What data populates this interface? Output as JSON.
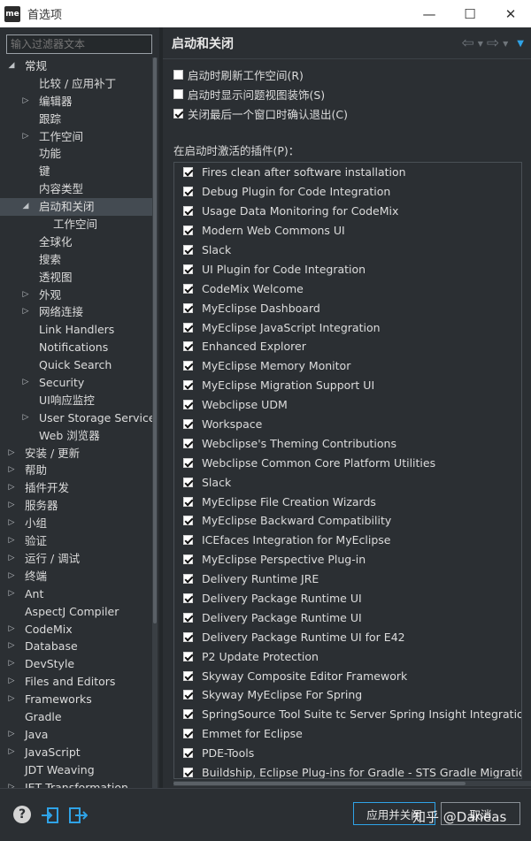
{
  "window": {
    "logo": "me",
    "title": "首选项",
    "minimize": "—",
    "maximize": "☐",
    "close": "✕"
  },
  "filter": {
    "placeholder": "输入过滤器文本"
  },
  "tree": [
    {
      "label": "常规",
      "level": 0,
      "arrow": "expanded"
    },
    {
      "label": "比较 / 应用补丁",
      "level": 1,
      "arrow": "none"
    },
    {
      "label": "编辑器",
      "level": 1,
      "arrow": "collapsed"
    },
    {
      "label": "跟踪",
      "level": 1,
      "arrow": "none"
    },
    {
      "label": "工作空间",
      "level": 1,
      "arrow": "collapsed"
    },
    {
      "label": "功能",
      "level": 1,
      "arrow": "none"
    },
    {
      "label": "键",
      "level": 1,
      "arrow": "none"
    },
    {
      "label": "内容类型",
      "level": 1,
      "arrow": "none"
    },
    {
      "label": "启动和关闭",
      "level": 1,
      "arrow": "expanded",
      "selected": true
    },
    {
      "label": "工作空间",
      "level": 2,
      "arrow": "none"
    },
    {
      "label": "全球化",
      "level": 1,
      "arrow": "none"
    },
    {
      "label": "搜索",
      "level": 1,
      "arrow": "none"
    },
    {
      "label": "透视图",
      "level": 1,
      "arrow": "none"
    },
    {
      "label": "外观",
      "level": 1,
      "arrow": "collapsed"
    },
    {
      "label": "网络连接",
      "level": 1,
      "arrow": "collapsed"
    },
    {
      "label": "Link Handlers",
      "level": 1,
      "arrow": "none"
    },
    {
      "label": "Notifications",
      "level": 1,
      "arrow": "none"
    },
    {
      "label": "Quick Search",
      "level": 1,
      "arrow": "none"
    },
    {
      "label": "Security",
      "level": 1,
      "arrow": "collapsed"
    },
    {
      "label": "UI响应监控",
      "level": 1,
      "arrow": "none"
    },
    {
      "label": "User Storage Service",
      "level": 1,
      "arrow": "collapsed"
    },
    {
      "label": "Web 浏览器",
      "level": 1,
      "arrow": "none"
    },
    {
      "label": "安装 / 更新",
      "level": 0,
      "arrow": "collapsed"
    },
    {
      "label": "帮助",
      "level": 0,
      "arrow": "collapsed"
    },
    {
      "label": "插件开发",
      "level": 0,
      "arrow": "collapsed"
    },
    {
      "label": "服务器",
      "level": 0,
      "arrow": "collapsed"
    },
    {
      "label": "小组",
      "level": 0,
      "arrow": "collapsed"
    },
    {
      "label": "验证",
      "level": 0,
      "arrow": "collapsed"
    },
    {
      "label": "运行 / 调试",
      "level": 0,
      "arrow": "collapsed"
    },
    {
      "label": "终端",
      "level": 0,
      "arrow": "collapsed"
    },
    {
      "label": "Ant",
      "level": 0,
      "arrow": "collapsed"
    },
    {
      "label": "AspectJ Compiler",
      "level": 0,
      "arrow": "none"
    },
    {
      "label": "CodeMix",
      "level": 0,
      "arrow": "collapsed"
    },
    {
      "label": "Database",
      "level": 0,
      "arrow": "collapsed"
    },
    {
      "label": "DevStyle",
      "level": 0,
      "arrow": "collapsed"
    },
    {
      "label": "Files and Editors",
      "level": 0,
      "arrow": "collapsed"
    },
    {
      "label": "Frameworks",
      "level": 0,
      "arrow": "collapsed"
    },
    {
      "label": "Gradle",
      "level": 0,
      "arrow": "none"
    },
    {
      "label": "Java",
      "level": 0,
      "arrow": "collapsed"
    },
    {
      "label": "JavaScript",
      "level": 0,
      "arrow": "collapsed"
    },
    {
      "label": "JDT Weaving",
      "level": 0,
      "arrow": "none"
    },
    {
      "label": "JET Transformation",
      "level": 0,
      "arrow": "collapsed"
    }
  ],
  "page": {
    "title": "启动和关闭",
    "back_icon": "arrow-left-icon",
    "forward_icon": "arrow-right-icon",
    "menu_icon": "view-menu-icon",
    "options": [
      {
        "label": "启动时刷新工作空间(R)",
        "checked": false
      },
      {
        "label": "启动时显示问题视图装饰(S)",
        "checked": false
      },
      {
        "label": "关闭最后一个窗口时确认退出(C)",
        "checked": true
      }
    ],
    "plugins_label": "在启动时激活的插件(P)：",
    "plugins": [
      "Fires clean after software installation",
      "Debug Plugin for Code Integration",
      "Usage Data Monitoring for CodeMix",
      "Modern Web Commons UI",
      "Slack",
      "UI Plugin for Code Integration",
      "CodeMix Welcome",
      "MyEclipse Dashboard",
      "MyEclipse JavaScript Integration",
      "Enhanced Explorer",
      "MyEclipse Memory Monitor",
      "MyEclipse Migration Support UI",
      "Webclipse UDM",
      "Workspace",
      "Webclipse's Theming Contributions",
      "Webclipse Common Core Platform Utilities",
      "Slack",
      "MyEclipse File Creation Wizards",
      "MyEclipse Backward Compatibility",
      "ICEfaces Integration for MyEclipse",
      "MyEclipse Perspective Plug-in",
      "Delivery Runtime JRE",
      "Delivery Package Runtime UI",
      "Delivery Package Runtime UI",
      "Delivery Package Runtime UI for E42",
      "P2 Update Protection",
      "Skyway Composite Editor Framework",
      "Skyway MyEclipse For Spring",
      "SpringSource Tool Suite tc Server Spring Insight Integration",
      "Emmet for Eclipse",
      "PDE-Tools",
      "Buildship, Eclipse Plug-ins for Gradle - STS Gradle Migration"
    ]
  },
  "footer": {
    "help_icon": "?",
    "import_icon": "import-icon",
    "export_icon": "export-icon",
    "apply_close": "应用并关闭",
    "cancel": "取消",
    "watermark": "知乎 @Daneas"
  },
  "colors": {
    "background": "#2b2f33",
    "accent": "#2fa3e7",
    "selection": "#444b52",
    "text": "#dcdcdc"
  }
}
